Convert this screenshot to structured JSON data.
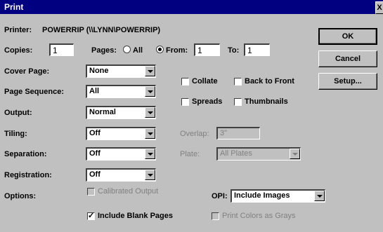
{
  "window": {
    "title": "Print",
    "close_glyph": "X"
  },
  "printer": {
    "label": "Printer:",
    "name": "POWERRIP (\\\\LYNN\\POWERRIP)"
  },
  "copies": {
    "label": "Copies:",
    "value": "1"
  },
  "pages": {
    "label": "Pages:",
    "all_label": "All",
    "from_label": "From:",
    "from_value": "1",
    "to_label": "To:",
    "to_value": "1"
  },
  "cover_page": {
    "label": "Cover Page:",
    "value": "None"
  },
  "page_sequence": {
    "label": "Page Sequence:",
    "value": "All"
  },
  "output": {
    "label": "Output:",
    "value": "Normal"
  },
  "tiling": {
    "label": "Tiling:",
    "value": "Off"
  },
  "separation": {
    "label": "Separation:",
    "value": "Off"
  },
  "registration": {
    "label": "Registration:",
    "value": "Off"
  },
  "checks": {
    "collate": "Collate",
    "back_to_front": "Back to Front",
    "spreads": "Spreads",
    "thumbnails": "Thumbnails"
  },
  "overlap": {
    "label": "Overlap:",
    "value": "3\""
  },
  "plate": {
    "label": "Plate:",
    "value": "All Plates"
  },
  "options": {
    "label": "Options:",
    "calibrated_output": "Calibrated Output",
    "include_blank_pages": "Include Blank Pages",
    "include_blank_pages_mark": "✓",
    "print_colors_as_grays": "Print Colors as Grays",
    "opi_label": "OPI:",
    "opi_value": "Include Images"
  },
  "buttons": {
    "ok": "OK",
    "cancel": "Cancel",
    "setup": "Setup..."
  }
}
